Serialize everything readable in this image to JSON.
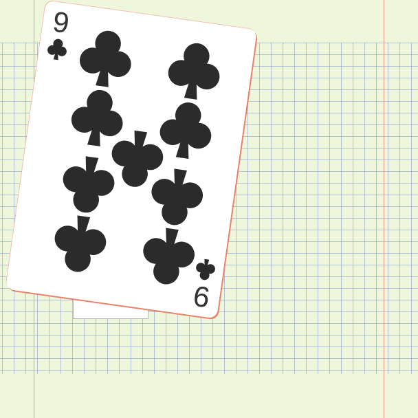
{
  "scene": {
    "background": "graph paper",
    "colors": {
      "paper": "#eef7dc",
      "grid": "#8796cd",
      "margin": "#e09a8a",
      "card": "#ffffff",
      "ink": "#2b2b2b"
    }
  },
  "card": {
    "rank": "9",
    "suit": "clubs",
    "suit_icon": "club-icon",
    "pip_count": 9
  }
}
